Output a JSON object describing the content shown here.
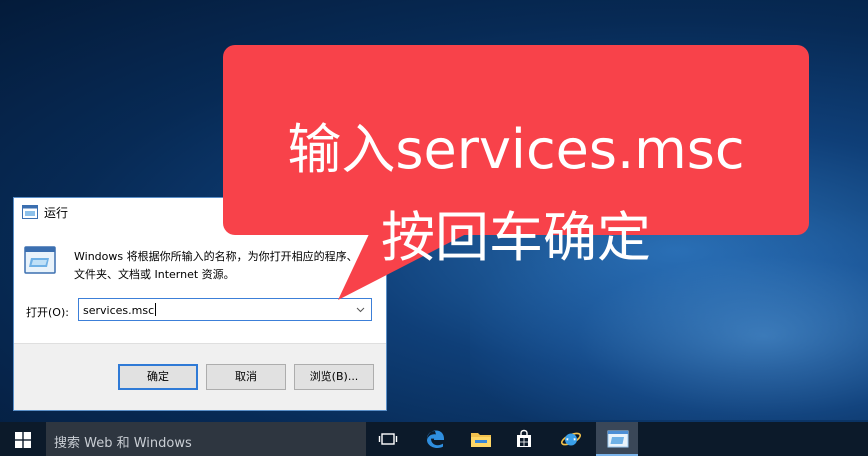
{
  "dialog": {
    "title": "运行",
    "description_line1": "Windows 将根据你所输入的名称，为你打开相应的程序、",
    "description_line2": "文件夹、文档或 Internet 资源。",
    "open_label": "打开(O):",
    "input_value": "services.msc",
    "ok_label": "确定",
    "cancel_label": "取消",
    "browse_label": "浏览(B)..."
  },
  "callout": {
    "line1": "输入services.msc",
    "line2": "按回车确定",
    "color": "#f8424a"
  },
  "taskbar": {
    "search_placeholder": "搜索 Web 和 Windows",
    "icons": [
      "task-view-icon",
      "edge-icon",
      "file-explorer-icon",
      "store-icon",
      "internet-explorer-icon",
      "run-icon"
    ]
  },
  "colors": {
    "accent": "#2f7ad6",
    "taskbar": "#0c1a2a",
    "search_box": "#2e3640"
  }
}
